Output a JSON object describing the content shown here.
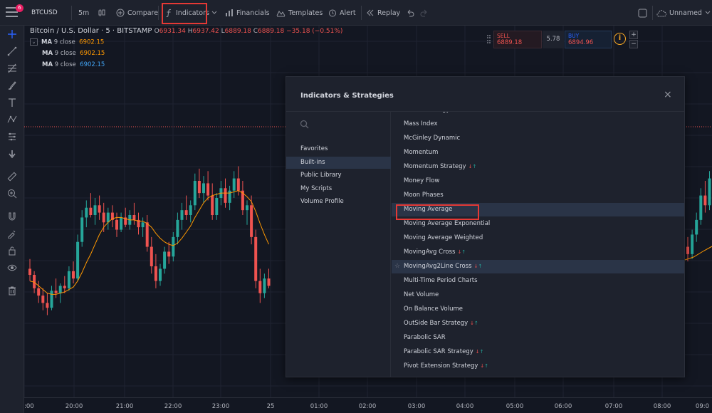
{
  "topbar": {
    "notif_count": "6",
    "symbol": "BTCUSD",
    "interval": "5m",
    "compare": "Compare",
    "indicators": "Indicators",
    "financials": "Financials",
    "templates": "Templates",
    "alert": "Alert",
    "replay": "Replay",
    "layout": "Unnamed"
  },
  "legend": {
    "title": "Bitcoin / U.S. Dollar · 5 · BITSTAMP",
    "ohlc": [
      {
        "k": "O",
        "v": "6931.34"
      },
      {
        "k": "H",
        "v": "6937.42"
      },
      {
        "k": "L",
        "v": "6889.18"
      },
      {
        "k": "C",
        "v": "6889.18"
      }
    ],
    "change": "−35.18 (−0.51%)",
    "ma_rows": [
      {
        "name": "MA",
        "params": "9 close",
        "value": "6902.15",
        "color": "#ff9800"
      },
      {
        "name": "MA",
        "params": "9 close",
        "value": "6902.15",
        "color": "#ff9800"
      },
      {
        "name": "MA",
        "params": "9 close",
        "value": "6902.15",
        "color": "#42a5f5"
      }
    ]
  },
  "trade": {
    "sell_label": "SELL",
    "sell_price": "6889.18",
    "spread": "5.78",
    "buy_label": "BUY",
    "buy_price": "6894.96",
    "info": "i",
    "plus": "+",
    "minus": "−"
  },
  "xaxis": {
    "ticks": [
      ":00",
      "20:00",
      "21:00",
      "22:00",
      "23:00",
      "25",
      "01:00",
      "02:00",
      "03:00",
      "04:00",
      "05:00",
      "06:00",
      "07:00",
      "08:00",
      "09:0"
    ]
  },
  "colors": {
    "up": "#26a69a",
    "down": "#ef5350",
    "ma": "#ff9800",
    "accent": "#2962ff",
    "highlight": "#e53935"
  },
  "dialog": {
    "title": "Indicators & Strategies",
    "close": "×",
    "categories": [
      {
        "label": "Favorites",
        "selected": false
      },
      {
        "label": "Built-ins",
        "selected": true
      },
      {
        "label": "Public Library",
        "selected": false
      },
      {
        "label": "My Scripts",
        "selected": false
      },
      {
        "label": "Volume Profile",
        "selected": false
      }
    ],
    "items": [
      {
        "label": "MACD Strategy",
        "arrows": true,
        "partial": true
      },
      {
        "label": "Mass Index"
      },
      {
        "label": "McGinley Dynamic"
      },
      {
        "label": "Momentum"
      },
      {
        "label": "Momentum Strategy",
        "arrows": true
      },
      {
        "label": "Money Flow"
      },
      {
        "label": "Moon Phases"
      },
      {
        "label": "Moving Average",
        "highlighted": true
      },
      {
        "label": "Moving Average Exponential"
      },
      {
        "label": "Moving Average Weighted"
      },
      {
        "label": "MovingAvg Cross",
        "arrows": true
      },
      {
        "label": "MovingAvg2Line Cross",
        "arrows": true,
        "hover": true
      },
      {
        "label": "Multi-Time Period Charts"
      },
      {
        "label": "Net Volume"
      },
      {
        "label": "On Balance Volume"
      },
      {
        "label": "OutSide Bar Strategy",
        "arrows": true
      },
      {
        "label": "Parabolic SAR"
      },
      {
        "label": "Parabolic SAR Strategy",
        "arrows": true
      },
      {
        "label": "Pivot Extension Strategy",
        "arrows": true
      }
    ]
  },
  "chart_data": {
    "type": "candlestick",
    "price_range": [
      6860,
      7000
    ],
    "grid": true,
    "candles": [
      [
        6900,
        6908,
        6890,
        6895
      ],
      [
        6895,
        6898,
        6880,
        6884
      ],
      [
        6884,
        6890,
        6872,
        6878
      ],
      [
        6878,
        6884,
        6866,
        6872
      ],
      [
        6872,
        6880,
        6862,
        6868
      ],
      [
        6868,
        6886,
        6866,
        6882
      ],
      [
        6882,
        6892,
        6876,
        6880
      ],
      [
        6880,
        6888,
        6872,
        6886
      ],
      [
        6886,
        6894,
        6880,
        6884
      ],
      [
        6884,
        6902,
        6882,
        6898
      ],
      [
        6898,
        6906,
        6888,
        6892
      ],
      [
        6892,
        6928,
        6890,
        6922
      ],
      [
        6922,
        6948,
        6918,
        6942
      ],
      [
        6942,
        6956,
        6934,
        6950
      ],
      [
        6950,
        6962,
        6942,
        6944
      ],
      [
        6944,
        6958,
        6936,
        6952
      ],
      [
        6952,
        6960,
        6940,
        6946
      ],
      [
        6946,
        6954,
        6930,
        6938
      ],
      [
        6938,
        6950,
        6932,
        6946
      ],
      [
        6946,
        6952,
        6934,
        6940
      ],
      [
        6940,
        6946,
        6926,
        6932
      ],
      [
        6932,
        6946,
        6930,
        6942
      ],
      [
        6942,
        6950,
        6934,
        6936
      ],
      [
        6936,
        6948,
        6932,
        6944
      ],
      [
        6944,
        6954,
        6936,
        6940
      ],
      [
        6940,
        6946,
        6928,
        6934
      ],
      [
        6934,
        6942,
        6926,
        6938
      ],
      [
        6938,
        6944,
        6914,
        6918
      ],
      [
        6918,
        6926,
        6896,
        6902
      ],
      [
        6902,
        6912,
        6884,
        6890
      ],
      [
        6890,
        6904,
        6886,
        6900
      ],
      [
        6900,
        6918,
        6896,
        6914
      ],
      [
        6914,
        6922,
        6904,
        6910
      ],
      [
        6910,
        6930,
        6906,
        6926
      ],
      [
        6926,
        6946,
        6920,
        6940
      ],
      [
        6940,
        6954,
        6932,
        6948
      ],
      [
        6948,
        6960,
        6940,
        6944
      ],
      [
        6944,
        6956,
        6938,
        6952
      ],
      [
        6952,
        6978,
        6948,
        6972
      ],
      [
        6972,
        6982,
        6958,
        6962
      ],
      [
        6962,
        6976,
        6954,
        6970
      ],
      [
        6970,
        6980,
        6956,
        6960
      ],
      [
        6960,
        6970,
        6940,
        6944
      ],
      [
        6944,
        6962,
        6940,
        6958
      ],
      [
        6958,
        6972,
        6952,
        6966
      ],
      [
        6966,
        6974,
        6950,
        6954
      ],
      [
        6954,
        6968,
        6948,
        6964
      ],
      [
        6964,
        6980,
        6958,
        6974
      ],
      [
        6974,
        6984,
        6960,
        6964
      ],
      [
        6964,
        6972,
        6944,
        6948
      ],
      [
        6948,
        6956,
        6936,
        6952
      ],
      [
        6952,
        6960,
        6920,
        6926
      ],
      [
        6926,
        6932,
        6884,
        6890
      ],
      [
        6890,
        6900,
        6872,
        6880
      ],
      [
        6880,
        6896,
        6876,
        6892
      ],
      [
        6892,
        6900,
        6884,
        6886
      ]
    ],
    "right_candles": [
      [
        6918,
        6926,
        6906,
        6912
      ],
      [
        6912,
        6932,
        6908,
        6928
      ],
      [
        6928,
        6946,
        6922,
        6940
      ],
      [
        6940,
        6966,
        6936,
        6960
      ],
      [
        6960,
        6972,
        6946,
        6952
      ],
      [
        6952,
        6980,
        6948,
        6974
      ]
    ],
    "ma_values": [
      6890,
      6889,
      6886,
      6883,
      6880,
      6879,
      6879,
      6880,
      6881,
      6883,
      6885,
      6890,
      6897,
      6905,
      6912,
      6920,
      6928,
      6934,
      6938,
      6941,
      6942,
      6942,
      6941,
      6940,
      6940,
      6939,
      6939,
      6937,
      6934,
      6929,
      6925,
      6922,
      6920,
      6919,
      6921,
      6925,
      6930,
      6935,
      6942,
      6948,
      6954,
      6958,
      6960,
      6961,
      6962,
      6962,
      6962,
      6963,
      6964,
      6962,
      6959,
      6955,
      6947,
      6937,
      6928,
      6920
    ]
  }
}
